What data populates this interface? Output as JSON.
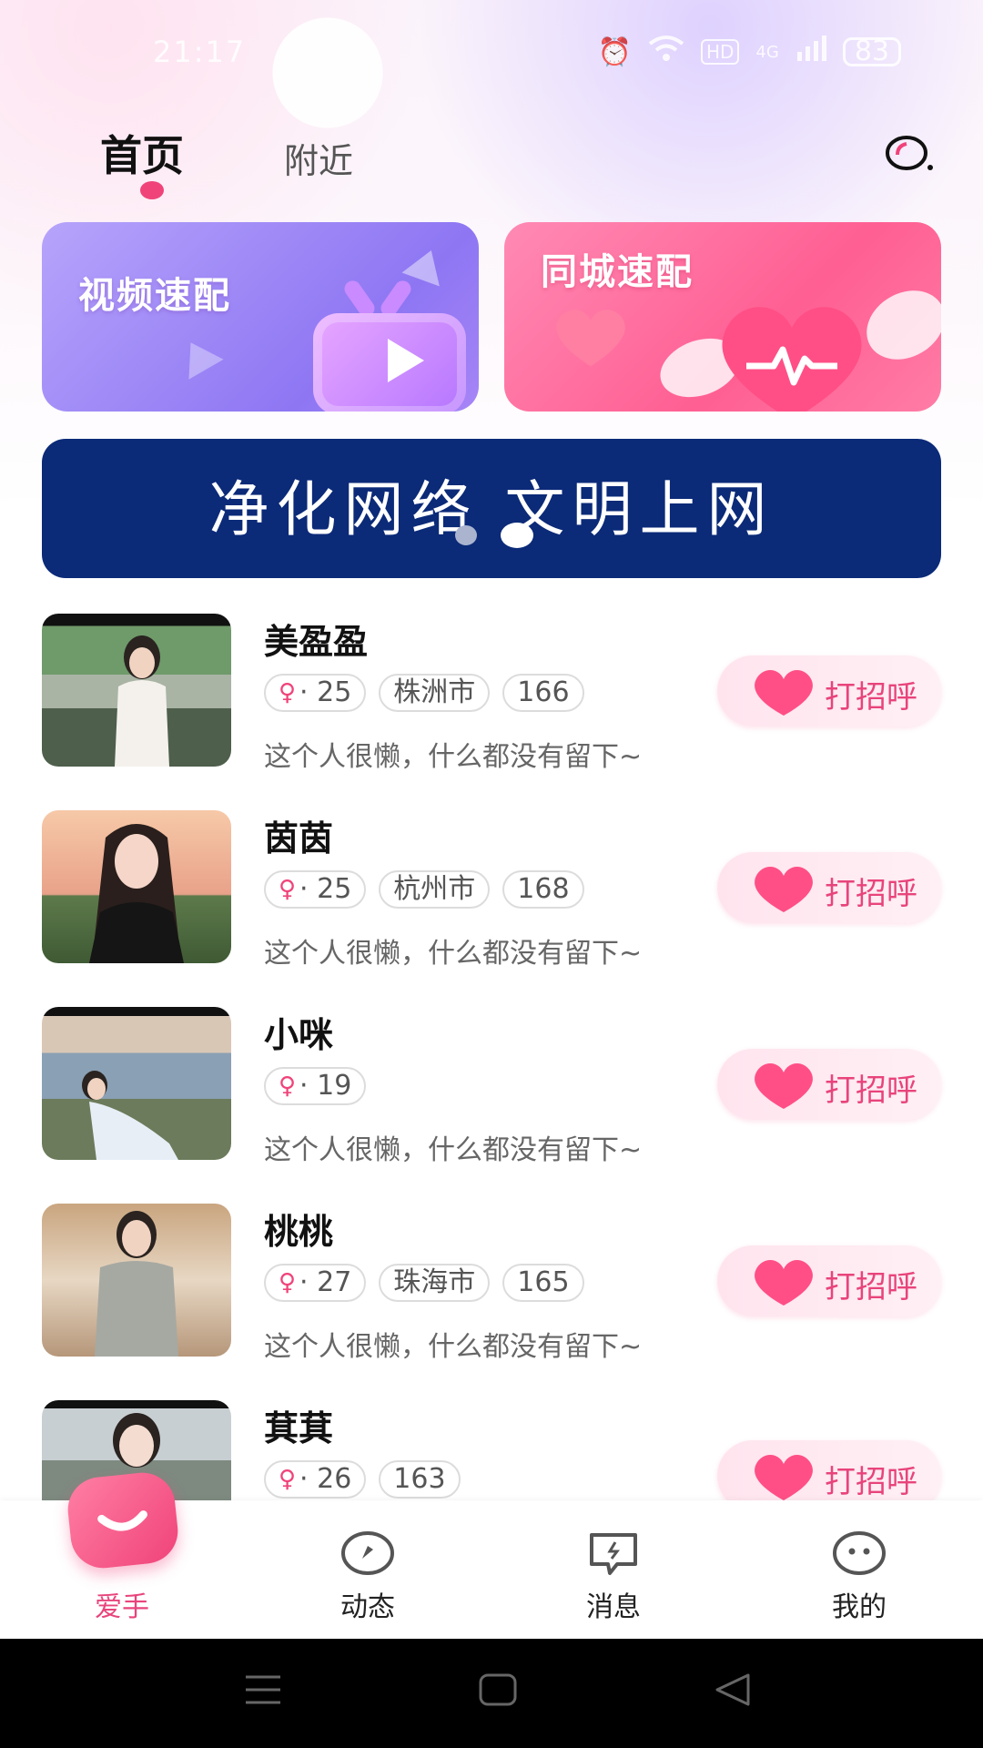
{
  "status_bar": {
    "time": "21:17",
    "battery": "83",
    "network": "4G",
    "hd": "HD"
  },
  "header": {
    "tabs": [
      {
        "label": "首页"
      },
      {
        "label": "附近"
      }
    ]
  },
  "promo_cards": {
    "video": {
      "title": "视频速配"
    },
    "city": {
      "title": "同城速配"
    }
  },
  "banner": {
    "text": "净化网络  文明上网",
    "slide_count": 2,
    "active_slide": 2
  },
  "users": [
    {
      "name": "美盈盈",
      "age": "· 25",
      "city": "株洲市",
      "height": "166",
      "bio": "这个人很懒，什么都没有留下~"
    },
    {
      "name": "茵茵",
      "age": "· 25",
      "city": "杭州市",
      "height": "168",
      "bio": "这个人很懒，什么都没有留下~"
    },
    {
      "name": "小咪",
      "age": "· 19",
      "bio": "这个人很懒，什么都没有留下~"
    },
    {
      "name": "桃桃",
      "age": "· 27",
      "city": "珠海市",
      "height": "165",
      "bio": "这个人很懒，什么都没有留下~"
    },
    {
      "name": "萁萁",
      "age": "· 26",
      "height": "163"
    }
  ],
  "greet_label": "打招呼",
  "bottom_nav": {
    "items": [
      {
        "label": "爱手"
      },
      {
        "label": "动态"
      },
      {
        "label": "消息"
      },
      {
        "label": "我的"
      }
    ]
  },
  "colors": {
    "accent": "#f0437a",
    "banner_bg": "#0b2a78"
  }
}
